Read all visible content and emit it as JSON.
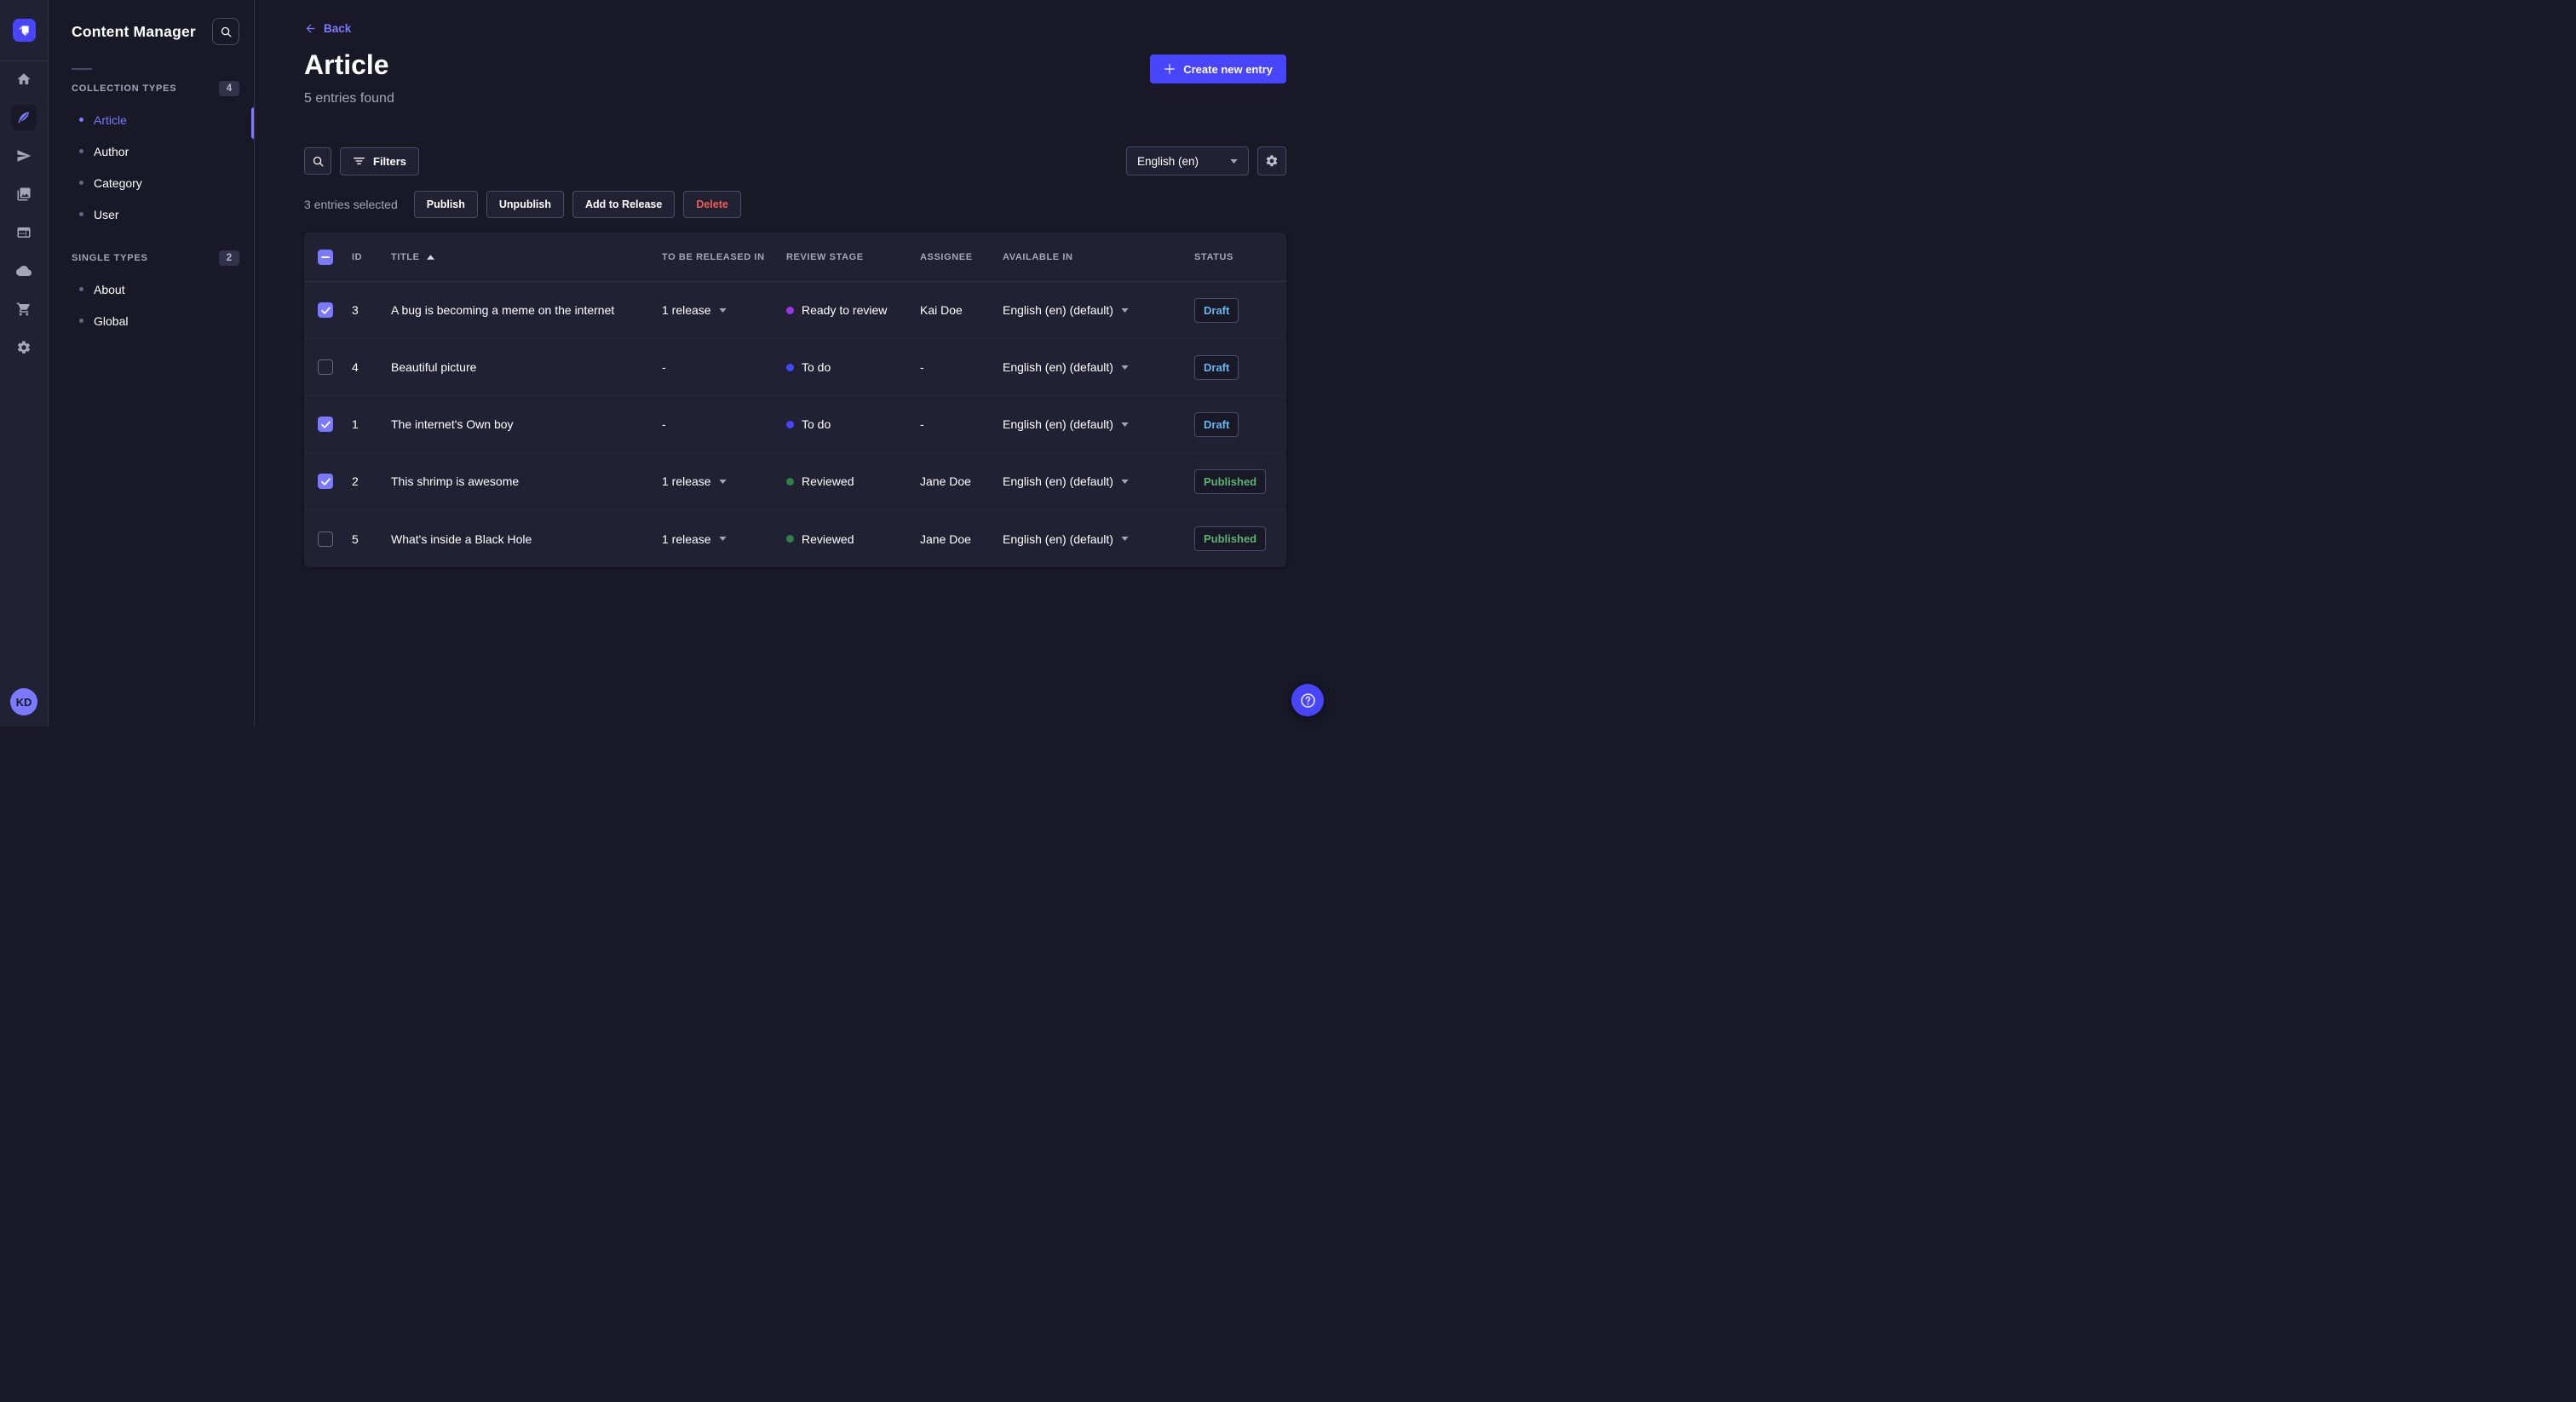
{
  "colors": {
    "accent": "#4945ff",
    "accent-light": "#7b79ff",
    "bg-app": "#181826",
    "bg-rail": "#212134",
    "bg-card": "#212134",
    "border": "#32324d",
    "border-strong": "#4a4a6a",
    "text-muted": "#a5a5ba",
    "danger": "#ee5e52",
    "status-draft": "#66b7f1",
    "status-published": "#5cb176",
    "stage-ready": "#9736e8",
    "stage-todo": "#4945ff",
    "stage-reviewed": "#328048",
    "checkbox-checked": "#7b79ff"
  },
  "rail": {
    "logo_icon": "strapi-logo",
    "items": [
      {
        "icon": "home-icon",
        "active": false
      },
      {
        "icon": "feather-icon",
        "active": true
      },
      {
        "icon": "paper-plane-icon",
        "active": false
      },
      {
        "icon": "images-icon",
        "active": false
      },
      {
        "icon": "layout-icon",
        "active": false
      },
      {
        "icon": "cloud-icon",
        "active": false
      },
      {
        "icon": "cart-icon",
        "active": false
      },
      {
        "icon": "gear-icon",
        "active": false
      }
    ],
    "avatar_initials": "KD"
  },
  "sidebar": {
    "title": "Content Manager",
    "sections": [
      {
        "label": "COLLECTION TYPES",
        "count": "4",
        "items": [
          {
            "label": "Article",
            "active": true
          },
          {
            "label": "Author",
            "active": false
          },
          {
            "label": "Category",
            "active": false
          },
          {
            "label": "User",
            "active": false
          }
        ]
      },
      {
        "label": "SINGLE TYPES",
        "count": "2",
        "items": [
          {
            "label": "About",
            "active": false
          },
          {
            "label": "Global",
            "active": false
          }
        ]
      }
    ]
  },
  "header": {
    "back_label": "Back",
    "title": "Article",
    "subtitle": "5 entries found",
    "create_label": "Create new entry"
  },
  "toolbar": {
    "filters_label": "Filters",
    "locale_value": "English (en)"
  },
  "selection": {
    "summary": "3 entries selected",
    "publish_label": "Publish",
    "unpublish_label": "Unpublish",
    "add_to_release_label": "Add to Release",
    "delete_label": "Delete"
  },
  "table": {
    "select_all_state": "indeterminate",
    "sort": {
      "column": "TITLE",
      "direction": "asc"
    },
    "columns": [
      "ID",
      "TITLE",
      "TO BE RELEASED IN",
      "REVIEW STAGE",
      "ASSIGNEE",
      "AVAILABLE IN",
      "STATUS"
    ],
    "rows": [
      {
        "checked": true,
        "id": "3",
        "title": "A bug is becoming a meme on the internet",
        "release": "1 release",
        "stage": "Ready to review",
        "stage_key": "ready",
        "assignee": "Kai Doe",
        "locale": "English (en) (default)",
        "status": "Draft",
        "status_key": "draft"
      },
      {
        "checked": false,
        "id": "4",
        "title": "Beautiful picture",
        "release": "-",
        "stage": "To do",
        "stage_key": "todo",
        "assignee": "-",
        "locale": "English (en) (default)",
        "status": "Draft",
        "status_key": "draft"
      },
      {
        "checked": true,
        "id": "1",
        "title": "The internet's Own boy",
        "release": "-",
        "stage": "To do",
        "stage_key": "todo",
        "assignee": "-",
        "locale": "English (en) (default)",
        "status": "Draft",
        "status_key": "draft"
      },
      {
        "checked": true,
        "id": "2",
        "title": "This shrimp is awesome",
        "release": "1 release",
        "stage": "Reviewed",
        "stage_key": "reviewed",
        "assignee": "Jane Doe",
        "locale": "English (en) (default)",
        "status": "Published",
        "status_key": "published"
      },
      {
        "checked": false,
        "id": "5",
        "title": "What's inside a Black Hole",
        "release": "1 release",
        "stage": "Reviewed",
        "stage_key": "reviewed",
        "assignee": "Jane Doe",
        "locale": "English (en) (default)",
        "status": "Published",
        "status_key": "published"
      }
    ]
  }
}
